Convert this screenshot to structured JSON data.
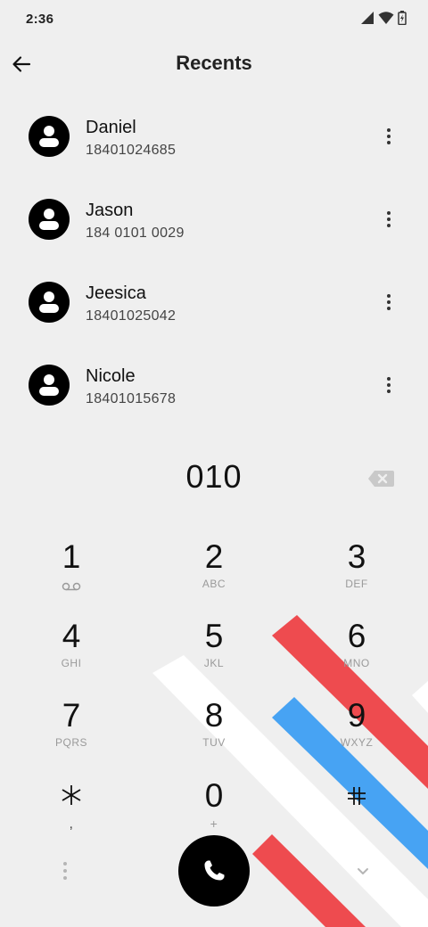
{
  "status_bar": {
    "time": "2:36",
    "icons": [
      "signal-icon",
      "wifi-icon",
      "battery-charging-icon"
    ]
  },
  "app_bar": {
    "title": "Recents",
    "back_icon": "arrow-left-icon"
  },
  "recents": [
    {
      "name": "Daniel",
      "number": "18401024685"
    },
    {
      "name": "Jason",
      "number": "184 0101 0029"
    },
    {
      "name": "Jeesica",
      "number": "18401025042"
    },
    {
      "name": "Nicole",
      "number": "18401015678"
    }
  ],
  "dialer": {
    "input": "010",
    "keys": [
      {
        "digit": "1",
        "letters": ""
      },
      {
        "digit": "2",
        "letters": "ABC"
      },
      {
        "digit": "3",
        "letters": "DEF"
      },
      {
        "digit": "4",
        "letters": "GHI"
      },
      {
        "digit": "5",
        "letters": "JKL"
      },
      {
        "digit": "6",
        "letters": "MNO"
      },
      {
        "digit": "7",
        "letters": "PQRS"
      },
      {
        "digit": "8",
        "letters": "TUV"
      },
      {
        "digit": "9",
        "letters": "WXYZ"
      },
      {
        "digit": "",
        "letters": ","
      },
      {
        "digit": "0",
        "letters": "+"
      },
      {
        "digit": "",
        "letters": ""
      }
    ]
  },
  "colors": {
    "background": "#efefef",
    "accent_red": "#ee4b4f",
    "accent_blue": "#47a3f3",
    "stripe_white": "#ffffff",
    "call_button": "#000000"
  }
}
